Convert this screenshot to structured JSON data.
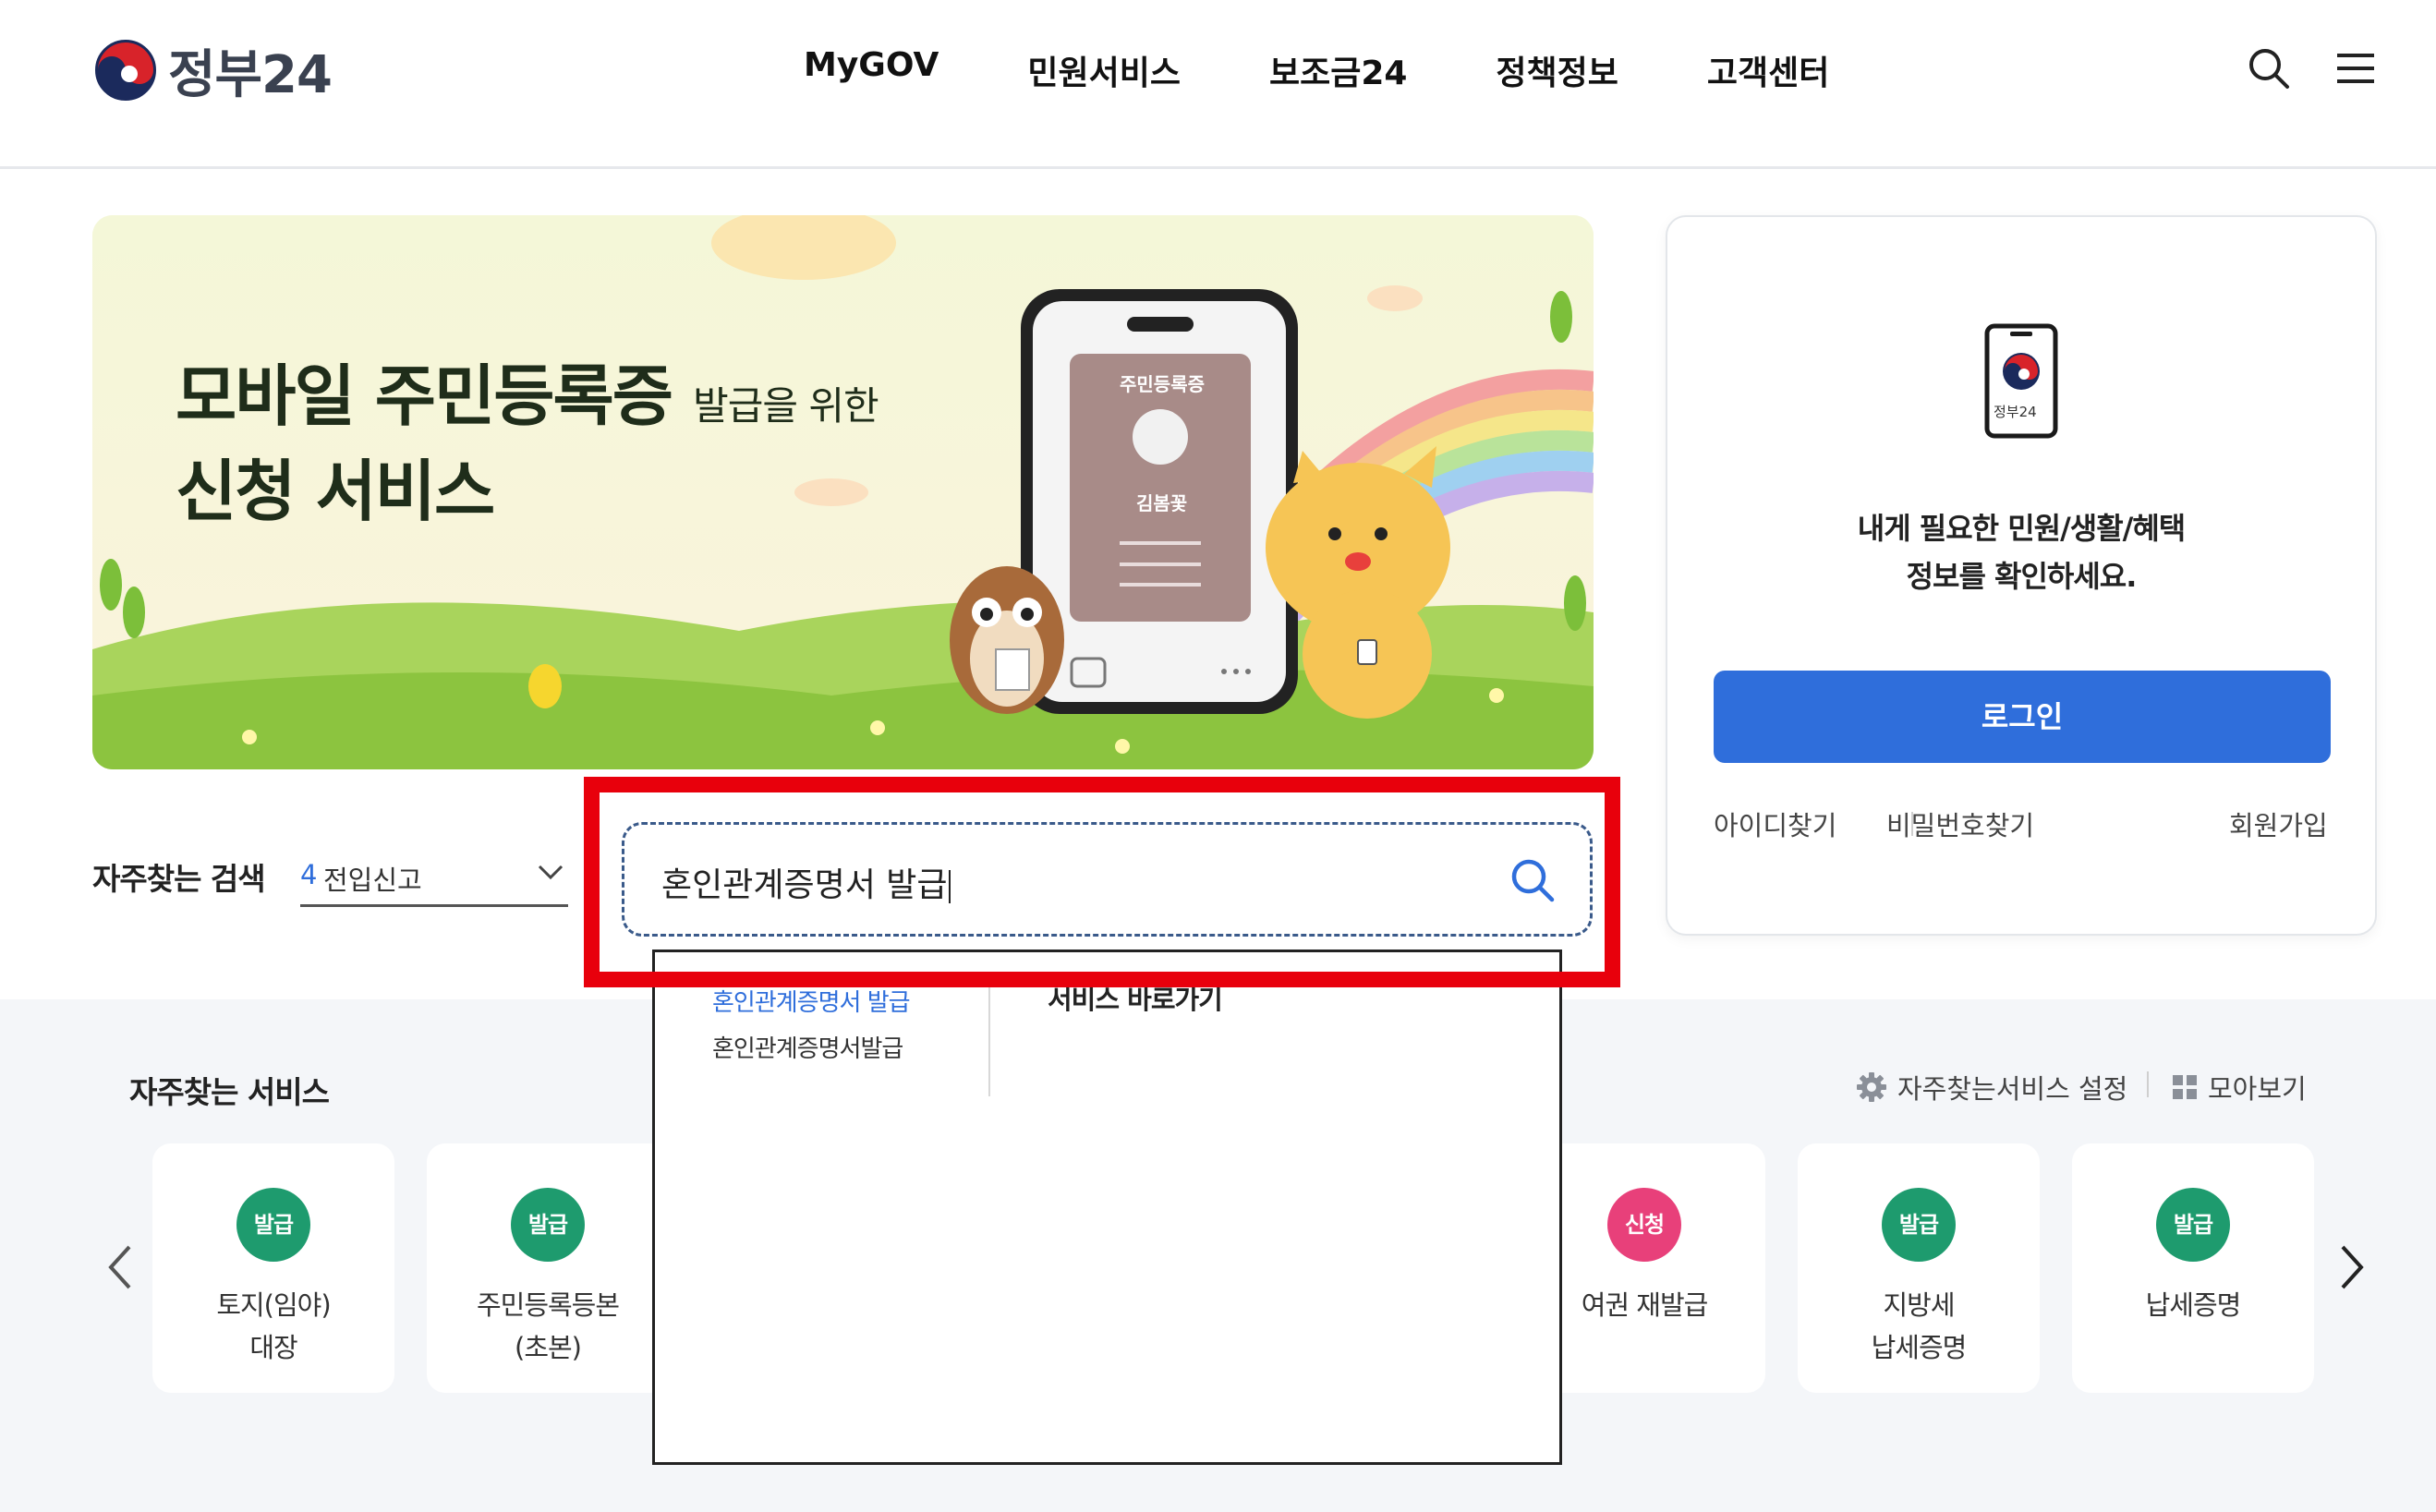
{
  "header": {
    "logo_text": "정부24",
    "nav": [
      "MyGOV",
      "민원서비스",
      "보조금24",
      "정책정보",
      "고객센터"
    ],
    "icons": [
      "search-icon",
      "hamburger-menu-icon"
    ]
  },
  "banner": {
    "title_main": "모바일 주민등록증",
    "title_small": "발급을 위한",
    "title_line2": "신청 서비스",
    "phone_card_label": "주민등록증",
    "phone_card_name": "김봄꽃"
  },
  "login": {
    "icon_label": "정부24",
    "message_line1": "내게 필요한 민원/생활/혜택",
    "message_line2": "정보를 확인하세요.",
    "button": "로그인",
    "find_id": "아이디찾기",
    "find_password": "비밀번호찾기",
    "signup": "회원가입"
  },
  "frequent_search": {
    "label": "자주찾는 검색",
    "selected_rank": "4",
    "selected_text": "전입신고"
  },
  "search": {
    "value": "혼인관계증명서 발급",
    "icon": "search-icon",
    "highlight_color": "#e8000c"
  },
  "autocomplete": {
    "suggestions": [
      "혼인관계증명서 발급",
      "혼인관계증명서발급"
    ],
    "shortcut_heading": "서비스 바로가기"
  },
  "services": {
    "heading": "자주찾는 서비스",
    "settings_label": "자주찾는서비스 설정",
    "view_all_label": "모아보기",
    "items": [
      {
        "badge": "발급",
        "badge_color": "#1e9b6e",
        "line1": "토지(임야)",
        "line2": "대장"
      },
      {
        "badge": "발급",
        "badge_color": "#1e9b6e",
        "line1": "주민등록등본",
        "line2": "(초본)"
      },
      {
        "badge": "신청",
        "badge_color": "#e8407a",
        "line1": "여권 재발급",
        "line2": ""
      },
      {
        "badge": "발급",
        "badge_color": "#1e9b6e",
        "line1": "지방세",
        "line2": "납세증명"
      },
      {
        "badge": "발급",
        "badge_color": "#1e9b6e",
        "line1": "납세증명",
        "line2": ""
      }
    ]
  },
  "colors": {
    "primary_blue": "#2f6edb",
    "issue_badge_green": "#1e9b6e",
    "apply_badge_pink": "#e8407a"
  }
}
